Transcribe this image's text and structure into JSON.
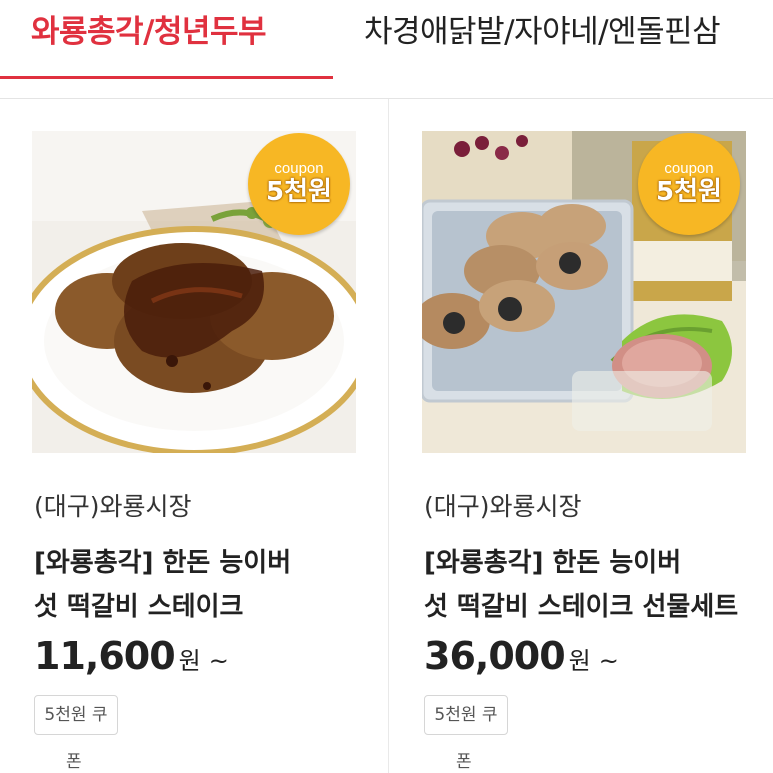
{
  "tabs": [
    {
      "label": "와룡총각/청년두부",
      "active": true
    },
    {
      "label": "차경애닭발/자야네/엔돌핀삼",
      "active": false
    }
  ],
  "colors": {
    "accent": "#e0313f",
    "badge": "#f7b724"
  },
  "products": [
    {
      "badge_top": "coupon",
      "badge_main": "5천원",
      "seller": "(대구)와룡시장",
      "title_line1": "[와룡총각] 한돈 능이버",
      "title_line2": "섯 떡갈비 스테이크",
      "price": "11,600",
      "unit": "원",
      "tilde": "~",
      "coupon_line1": "5천원 쿠",
      "coupon_line2": "폰"
    },
    {
      "badge_top": "coupon",
      "badge_main": "5천원",
      "seller": "(대구)와룡시장",
      "title_line1": "[와룡총각] 한돈 능이버",
      "title_line2": "섯 떡갈비 스테이크 선물세트",
      "price": "36,000",
      "unit": "원",
      "tilde": "~",
      "coupon_line1": "5천원 쿠",
      "coupon_line2": "폰"
    }
  ]
}
